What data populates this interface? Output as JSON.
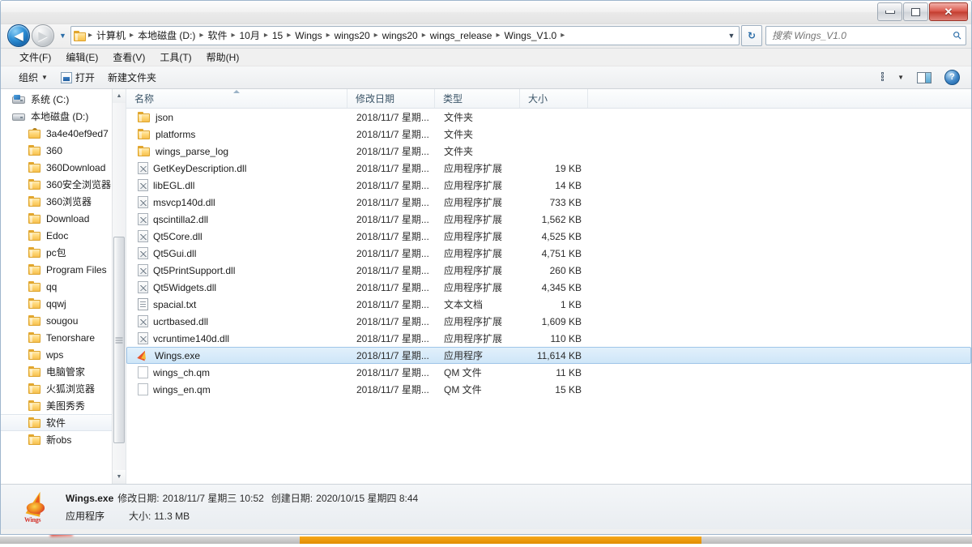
{
  "window": {
    "title_obscured": true,
    "controls": {
      "minimize_label": "",
      "maximize_label": "",
      "close_label": "✕"
    }
  },
  "address_bar": {
    "back_label": "◀",
    "forward_label": "▶",
    "history_label": "▼",
    "folder_icon": "folder-icon",
    "crumbs": [
      "计算机",
      "本地磁盘 (D:)",
      "软件",
      "10月",
      "15",
      "Wings",
      "wings20",
      "wings20",
      "wings_release",
      "Wings_V1.0"
    ],
    "separator": "▸",
    "dropdown_label": "▼",
    "refresh_label": "↻"
  },
  "search": {
    "placeholder": "搜索 Wings_V1.0",
    "value": "",
    "icon": "search-icon"
  },
  "menu": {
    "items": [
      {
        "text": "文件(F)",
        "pre": "文件(",
        "key": "F",
        "post": ")"
      },
      {
        "text": "编辑(E)",
        "pre": "编辑(",
        "key": "E",
        "post": ")"
      },
      {
        "text": "查看(V)",
        "pre": "查看(",
        "key": "V",
        "post": ")"
      },
      {
        "text": "工具(T)",
        "pre": "工具(",
        "key": "T",
        "post": ")"
      },
      {
        "text": "帮助(H)",
        "pre": "帮助(",
        "key": "H",
        "post": ")"
      }
    ]
  },
  "toolbar": {
    "organize_label": "组织",
    "organize_caret": "▼",
    "open_label": "打开",
    "new_folder_label": "新建文件夹",
    "view_caret": "▼",
    "help_glyph": "?"
  },
  "sidebar": {
    "items": [
      {
        "label": "系统 (C:)",
        "icon": "drive-icon",
        "indent": false,
        "selected": false
      },
      {
        "label": "本地磁盘 (D:)",
        "icon": "drive-icon",
        "indent": false,
        "selected": false
      },
      {
        "label": "3a4e40ef9ed7",
        "icon": "locked-folder-icon",
        "indent": true,
        "selected": false
      },
      {
        "label": "360",
        "icon": "folder-icon",
        "indent": true,
        "selected": false
      },
      {
        "label": "360Download",
        "icon": "folder-icon",
        "indent": true,
        "selected": false
      },
      {
        "label": "360安全浏览器",
        "icon": "folder-icon",
        "indent": true,
        "selected": false
      },
      {
        "label": "360浏览器",
        "icon": "folder-icon",
        "indent": true,
        "selected": false
      },
      {
        "label": "Download",
        "icon": "folder-icon",
        "indent": true,
        "selected": false
      },
      {
        "label": "Edoc",
        "icon": "folder-icon",
        "indent": true,
        "selected": false
      },
      {
        "label": "pc包",
        "icon": "folder-icon",
        "indent": true,
        "selected": false
      },
      {
        "label": "Program Files",
        "icon": "folder-icon",
        "indent": true,
        "selected": false
      },
      {
        "label": "qq",
        "icon": "folder-icon",
        "indent": true,
        "selected": false
      },
      {
        "label": "qqwj",
        "icon": "folder-icon",
        "indent": true,
        "selected": false
      },
      {
        "label": "sougou",
        "icon": "folder-icon",
        "indent": true,
        "selected": false
      },
      {
        "label": "Tenorshare",
        "icon": "folder-icon",
        "indent": true,
        "selected": false
      },
      {
        "label": "wps",
        "icon": "folder-icon",
        "indent": true,
        "selected": false
      },
      {
        "label": "电脑管家",
        "icon": "folder-icon",
        "indent": true,
        "selected": false
      },
      {
        "label": "火狐浏览器",
        "icon": "folder-icon",
        "indent": true,
        "selected": false
      },
      {
        "label": "美图秀秀",
        "icon": "folder-icon",
        "indent": true,
        "selected": false
      },
      {
        "label": "软件",
        "icon": "folder-icon",
        "indent": true,
        "selected": true
      },
      {
        "label": "新obs",
        "icon": "folder-icon",
        "indent": true,
        "selected": false
      }
    ],
    "scroll_up_label": "▲",
    "scroll_down_label": "▼"
  },
  "file_list": {
    "columns": [
      {
        "label": "名称",
        "sorted": "asc"
      },
      {
        "label": "修改日期",
        "sorted": ""
      },
      {
        "label": "类型",
        "sorted": ""
      },
      {
        "label": "大小",
        "sorted": ""
      }
    ],
    "sort_arrow": "▲",
    "rows": [
      {
        "name": "json",
        "date": "2018/11/7 星期...",
        "type": "文件夹",
        "size": "",
        "icon": "folder-icon",
        "selected": false
      },
      {
        "name": "platforms",
        "date": "2018/11/7 星期...",
        "type": "文件夹",
        "size": "",
        "icon": "folder-icon",
        "selected": false
      },
      {
        "name": "wings_parse_log",
        "date": "2018/11/7 星期...",
        "type": "文件夹",
        "size": "",
        "icon": "folder-icon",
        "selected": false
      },
      {
        "name": "GetKeyDescription.dll",
        "date": "2018/11/7 星期...",
        "type": "应用程序扩展",
        "size": "19 KB",
        "icon": "dll-icon",
        "selected": false
      },
      {
        "name": "libEGL.dll",
        "date": "2018/11/7 星期...",
        "type": "应用程序扩展",
        "size": "14 KB",
        "icon": "dll-icon",
        "selected": false
      },
      {
        "name": "msvcp140d.dll",
        "date": "2018/11/7 星期...",
        "type": "应用程序扩展",
        "size": "733 KB",
        "icon": "dll-icon",
        "selected": false
      },
      {
        "name": "qscintilla2.dll",
        "date": "2018/11/7 星期...",
        "type": "应用程序扩展",
        "size": "1,562 KB",
        "icon": "dll-icon",
        "selected": false
      },
      {
        "name": "Qt5Core.dll",
        "date": "2018/11/7 星期...",
        "type": "应用程序扩展",
        "size": "4,525 KB",
        "icon": "dll-icon",
        "selected": false
      },
      {
        "name": "Qt5Gui.dll",
        "date": "2018/11/7 星期...",
        "type": "应用程序扩展",
        "size": "4,751 KB",
        "icon": "dll-icon",
        "selected": false
      },
      {
        "name": "Qt5PrintSupport.dll",
        "date": "2018/11/7 星期...",
        "type": "应用程序扩展",
        "size": "260 KB",
        "icon": "dll-icon",
        "selected": false
      },
      {
        "name": "Qt5Widgets.dll",
        "date": "2018/11/7 星期...",
        "type": "应用程序扩展",
        "size": "4,345 KB",
        "icon": "dll-icon",
        "selected": false
      },
      {
        "name": "spacial.txt",
        "date": "2018/11/7 星期...",
        "type": "文本文档",
        "size": "1 KB",
        "icon": "text-file-icon",
        "selected": false
      },
      {
        "name": "ucrtbased.dll",
        "date": "2018/11/7 星期...",
        "type": "应用程序扩展",
        "size": "1,609 KB",
        "icon": "dll-icon",
        "selected": false
      },
      {
        "name": "vcruntime140d.dll",
        "date": "2018/11/7 星期...",
        "type": "应用程序扩展",
        "size": "110 KB",
        "icon": "dll-icon",
        "selected": false
      },
      {
        "name": "Wings.exe",
        "date": "2018/11/7 星期...",
        "type": "应用程序",
        "size": "11,614 KB",
        "icon": "wings-app-icon",
        "selected": true
      },
      {
        "name": "wings_ch.qm",
        "date": "2018/11/7 星期...",
        "type": "QM 文件",
        "size": "11 KB",
        "icon": "qm-file-icon",
        "selected": false
      },
      {
        "name": "wings_en.qm",
        "date": "2018/11/7 星期...",
        "type": "QM 文件",
        "size": "15 KB",
        "icon": "qm-file-icon",
        "selected": false
      }
    ]
  },
  "details_pane": {
    "file_name": "Wings.exe",
    "modified_label": "修改日期:",
    "modified_value": "2018/11/7 星期三 10:52",
    "created_label": "创建日期:",
    "created_value": "2020/10/15 星期四 8:44",
    "file_type": "应用程序",
    "size_label": "大小:",
    "size_value": "11.3 MB",
    "icon": "wings-app-icon",
    "icon_wordmark": "Wings"
  }
}
